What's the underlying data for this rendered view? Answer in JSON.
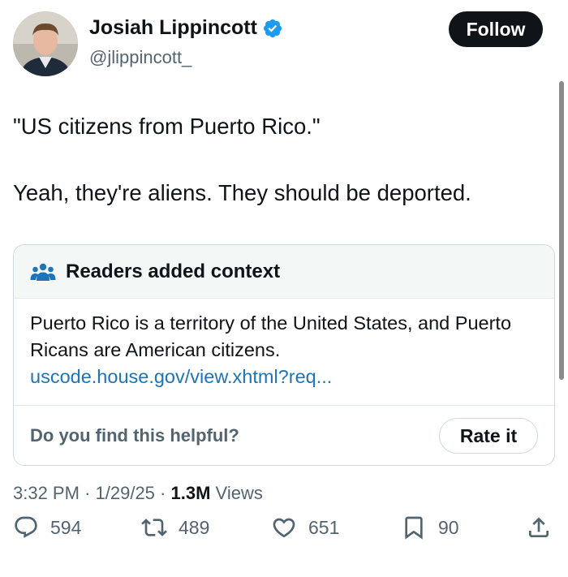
{
  "author": {
    "name": "Josiah Lippincott",
    "handle": "@jlippincott_",
    "verified": true
  },
  "follow_label": "Follow",
  "tweet": {
    "line1": "\"US citizens from Puerto Rico.\"",
    "line2": "Yeah, they're aliens. They should be deported."
  },
  "community_note": {
    "title": "Readers added context",
    "text": "Puerto Rico is a territory of the United States, and Puerto Ricans are American citizens.",
    "link": "uscode.house.gov/view.xhtml?req...",
    "question": "Do you find this helpful?",
    "rate_label": "Rate it"
  },
  "meta": {
    "time": "3:32 PM",
    "date": "1/29/25",
    "views_count": "1.3M",
    "views_label": "Views"
  },
  "actions": {
    "replies": "594",
    "reposts": "489",
    "likes": "651",
    "bookmarks": "90"
  },
  "colors": {
    "accent_link": "#1d74b8",
    "verified_badge": "#1d9bf0",
    "note_header_bg": "#f3f8f7",
    "muted_text": "#536471"
  }
}
